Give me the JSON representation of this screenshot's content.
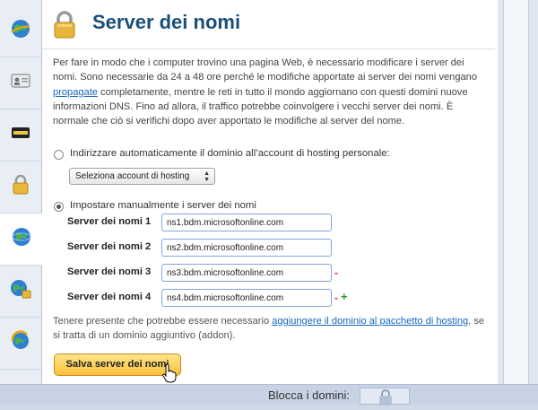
{
  "sidebar": {
    "items": [
      {
        "icon": "globe-icon"
      },
      {
        "icon": "contact-card-icon"
      },
      {
        "icon": "badge-icon"
      },
      {
        "icon": "padlock-icon"
      },
      {
        "icon": "globe-icon"
      },
      {
        "icon": "globe-lock-icon"
      },
      {
        "icon": "globe-refresh-icon"
      }
    ]
  },
  "header": {
    "title": "Server dei nomi",
    "icon": "padlock-icon"
  },
  "intro": {
    "text_before_link": "Per fare in modo che i computer trovino una pagina Web, è necessario modificare i server dei nomi. Sono necessarie da 24 a 48 ore perché le modifiche apportate ai server dei nomi vengano ",
    "link": "propagate",
    "text_after_link": " completamente, mentre le reti in tutto il mondo aggiornano con questi domini nuove informazioni DNS. Fino ad allora, il traffico potrebbe coinvolgere i vecchi server dei nomi. È normale che ciò si verifichi dopo aver apportato le modifiche al server del nome."
  },
  "option_auto": {
    "label": "Indirizzare automaticamente il dominio all’account di hosting personale:",
    "selected": false,
    "select_value": "Seleziona account di hosting"
  },
  "option_manual": {
    "label": "Impostare manualmente i server dei nomi",
    "selected": true
  },
  "nameservers": [
    {
      "label": "Server dei nomi 1",
      "value": "ns1.bdm.microsoftonline.com",
      "minus": false,
      "plus": false
    },
    {
      "label": "Server dei nomi 2",
      "value": "ns2.bdm.microsoftonline.com",
      "minus": false,
      "plus": false
    },
    {
      "label": "Server dei nomi 3",
      "value": "ns3.bdm.microsoftonline.com",
      "minus": true,
      "plus": false
    },
    {
      "label": "Server dei nomi 4",
      "value": "ns4.bdm.microsoftonline.com",
      "minus": true,
      "plus": true
    }
  ],
  "controls": {
    "minus": "-",
    "plus": "+"
  },
  "note": {
    "text_before_link": "Tenere presente che potrebbe essere necessario ",
    "link": "aggiungere il dominio al pacchetto di hosting",
    "text_after_link": ", se si tratta di un dominio aggiuntivo (addon)."
  },
  "save_button": "Salva server dei nomi",
  "footer": {
    "label": "Blocca i domini:"
  },
  "colors": {
    "title": "#1a4f7a",
    "link": "#1565c0",
    "button": "#f7c23a",
    "minus": "#d32f2f",
    "plus": "#2e9a2e"
  }
}
